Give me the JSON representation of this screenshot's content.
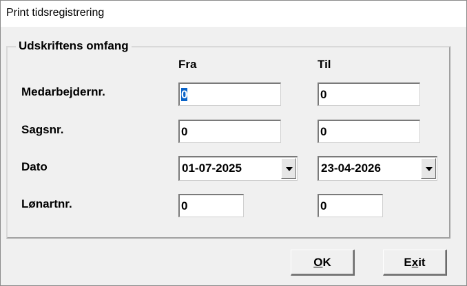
{
  "window": {
    "title": "Print tidsregistrering"
  },
  "group": {
    "label": "Udskriftens omfang"
  },
  "columns": {
    "from": "Fra",
    "to": "Til"
  },
  "rows": {
    "employee": {
      "label": "Medarbejdernr.",
      "from": "0",
      "to": "0"
    },
    "case": {
      "label": "Sagsnr.",
      "from": "0",
      "to": "0"
    },
    "date": {
      "label": "Dato",
      "from": "01-07-2025",
      "to": "23-04-2026"
    },
    "wagetype": {
      "label": "Lønartnr.",
      "from": "0",
      "to": "0"
    }
  },
  "buttons": {
    "ok": {
      "mnemonic": "O",
      "rest": "K"
    },
    "exit": {
      "pre": "E",
      "mnemonic": "x",
      "rest": "it"
    }
  },
  "icons": {
    "combo_arrow": "chevron-down-icon"
  }
}
